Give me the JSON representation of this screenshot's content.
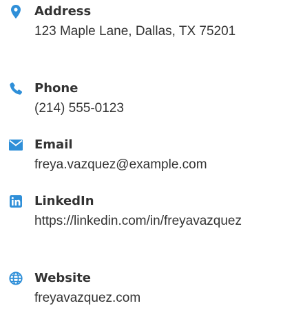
{
  "colors": {
    "accent": "#2f8fd8",
    "text": "#333333"
  },
  "contacts": [
    {
      "icon": "map-pin-icon",
      "label": "Address",
      "value": "123 Maple Lane, Dallas, TX 75201"
    },
    {
      "icon": "phone-icon",
      "label": "Phone",
      "value": "(214) 555-0123"
    },
    {
      "icon": "email-icon",
      "label": "Email",
      "value": "freya.vazquez@example.com"
    },
    {
      "icon": "linkedin-icon",
      "label": "LinkedIn",
      "value": "https://linkedin.com/in/freyavazquez"
    },
    {
      "icon": "globe-icon",
      "label": "Website",
      "value": "freyavazquez.com"
    }
  ]
}
